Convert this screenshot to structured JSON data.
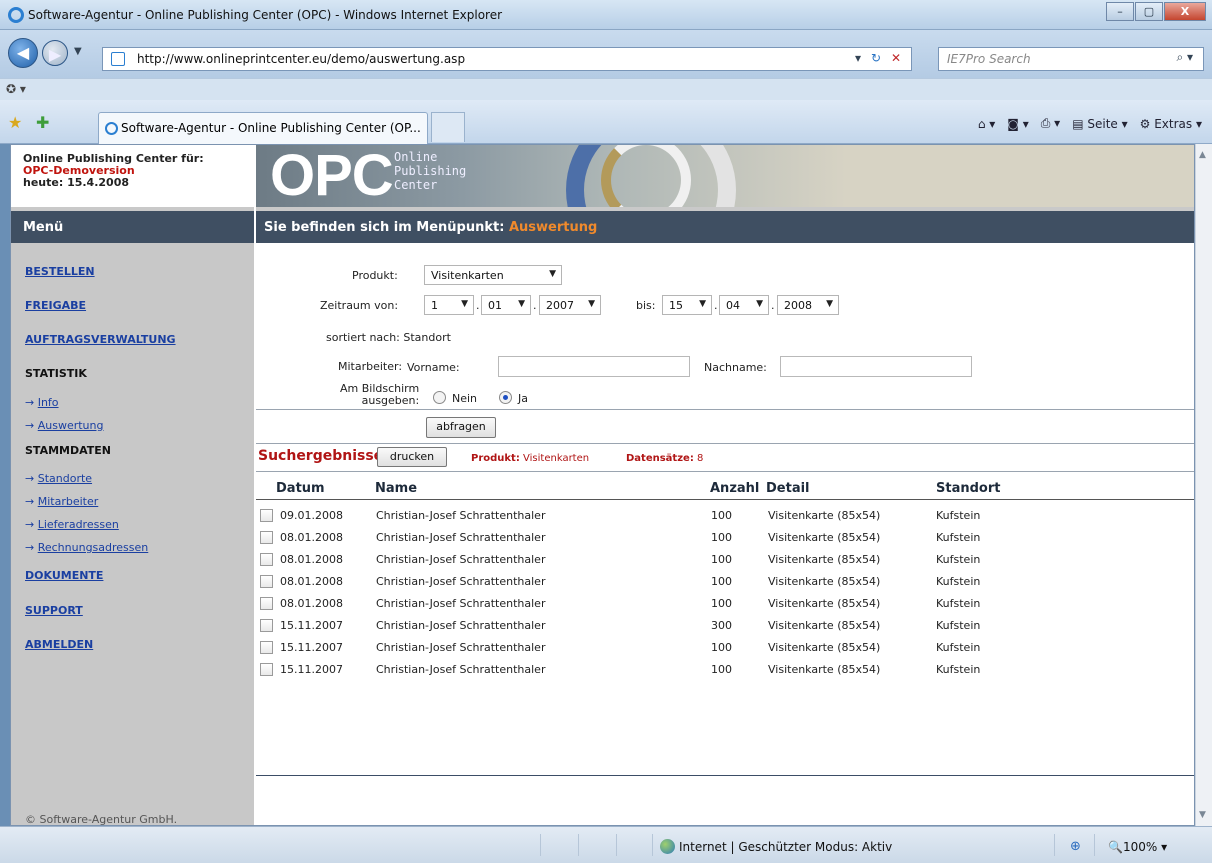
{
  "window": {
    "title": "Software-Agentur - Online Publishing Center (OPC) - Windows Internet Explorer",
    "minimize": "–",
    "maximize": "▢",
    "close": "X"
  },
  "browser": {
    "url": "http://www.onlineprintcenter.eu/demo/auswertung.asp",
    "search_placeholder": "IE7Pro Search",
    "tab_label": "Software-Agentur - Online Publishing Center (OP...",
    "toolbar": {
      "page": "Seite",
      "extras": "Extras"
    },
    "status_zone": "Internet | Geschützter Modus: Aktiv",
    "zoom": "100%"
  },
  "sidebar": {
    "info_line1": "Online Publishing Center für:",
    "info_line2": "OPC-Demoversion",
    "info_line3": "heute: 15.4.2008",
    "menu_title": "Menü",
    "items": [
      {
        "label": "BESTELLEN"
      },
      {
        "label": "FREIGABE"
      },
      {
        "label": "AUFTRAGSVERWALTUNG"
      }
    ],
    "statistik_title": "STATISTIK",
    "statistik_items": [
      {
        "label": "Info"
      },
      {
        "label": "Auswertung"
      }
    ],
    "stammdaten_title": "STAMMDATEN",
    "stammdaten_items": [
      {
        "label": "Standorte"
      },
      {
        "label": "Mitarbeiter"
      },
      {
        "label": "Lieferadressen"
      },
      {
        "label": "Rechnungsadressen"
      }
    ],
    "bottom_items": [
      {
        "label": "DOKUMENTE"
      },
      {
        "label": "SUPPORT"
      },
      {
        "label": "ABMELDEN"
      }
    ],
    "footer": "© Software-Agentur GmbH."
  },
  "banner": {
    "logo": "OPC",
    "sub1": "Online",
    "sub2": "Publishing",
    "sub3": "Center"
  },
  "header": {
    "prefix": "Sie befinden sich im Menüpunkt:",
    "current": "Auswertung"
  },
  "form": {
    "produkt_label": "Produkt:",
    "produkt_value": "Visitenkarten",
    "zeitraum_label": "Zeitraum von:",
    "from_day": "1",
    "from_month": "01",
    "from_year": "2007",
    "bis_label": "bis:",
    "to_day": "15",
    "to_month": "04",
    "to_year": "2008",
    "sortiert_label": "sortiert nach: Standort",
    "mitarbeiter_label": "Mitarbeiter:",
    "vorname_label": "Vorname:",
    "nachname_label": "Nachname:",
    "bildschirm_label1": "Am Bildschirm",
    "bildschirm_label2": "ausgeben:",
    "nein": "Nein",
    "ja": "Ja",
    "abfragen": "abfragen"
  },
  "results": {
    "title": "Suchergebnisse",
    "drucken": "drucken",
    "produkt_label": "Produkt:",
    "produkt_value": "Visitenkarten",
    "datensaetze_label": "Datensätze:",
    "datensaetze_value": "8",
    "columns": [
      "Datum",
      "Name",
      "Anzahl",
      "Detail",
      "Standort"
    ],
    "rows": [
      {
        "datum": "09.01.2008",
        "name": "Christian-Josef Schrattenthaler",
        "anzahl": "100",
        "detail": "Visitenkarte (85x54)",
        "standort": "Kufstein"
      },
      {
        "datum": "08.01.2008",
        "name": "Christian-Josef Schrattenthaler",
        "anzahl": "100",
        "detail": "Visitenkarte (85x54)",
        "standort": "Kufstein"
      },
      {
        "datum": "08.01.2008",
        "name": "Christian-Josef Schrattenthaler",
        "anzahl": "100",
        "detail": "Visitenkarte (85x54)",
        "standort": "Kufstein"
      },
      {
        "datum": "08.01.2008",
        "name": "Christian-Josef Schrattenthaler",
        "anzahl": "100",
        "detail": "Visitenkarte (85x54)",
        "standort": "Kufstein"
      },
      {
        "datum": "08.01.2008",
        "name": "Christian-Josef Schrattenthaler",
        "anzahl": "100",
        "detail": "Visitenkarte (85x54)",
        "standort": "Kufstein"
      },
      {
        "datum": "15.11.2007",
        "name": "Christian-Josef Schrattenthaler",
        "anzahl": "300",
        "detail": "Visitenkarte (85x54)",
        "standort": "Kufstein"
      },
      {
        "datum": "15.11.2007",
        "name": "Christian-Josef Schrattenthaler",
        "anzahl": "100",
        "detail": "Visitenkarte (85x54)",
        "standort": "Kufstein"
      },
      {
        "datum": "15.11.2007",
        "name": "Christian-Josef Schrattenthaler",
        "anzahl": "100",
        "detail": "Visitenkarte (85x54)",
        "standort": "Kufstein"
      }
    ]
  }
}
